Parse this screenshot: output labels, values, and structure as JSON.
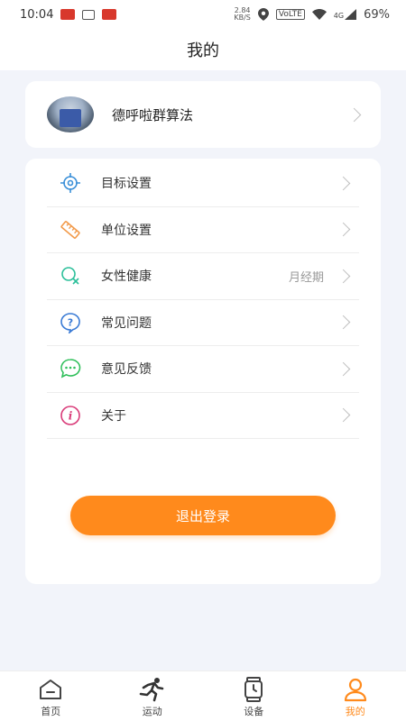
{
  "status_bar": {
    "time": "10:04",
    "speed_value": "2.84",
    "speed_unit": "KB/S",
    "volte": "VoLTE",
    "network": "4G",
    "battery": "69%"
  },
  "header": {
    "title": "我的"
  },
  "profile": {
    "name": "德呼啦群算法"
  },
  "menu": {
    "items": [
      {
        "label": "目标设置",
        "value": ""
      },
      {
        "label": "单位设置",
        "value": ""
      },
      {
        "label": "女性健康",
        "value": "月经期"
      },
      {
        "label": "常见问题",
        "value": ""
      },
      {
        "label": "意见反馈",
        "value": ""
      },
      {
        "label": "关于",
        "value": ""
      }
    ]
  },
  "logout_label": "退出登录",
  "tabs": [
    {
      "label": "首页",
      "active": false
    },
    {
      "label": "运动",
      "active": false
    },
    {
      "label": "设备",
      "active": false
    },
    {
      "label": "我的",
      "active": true
    }
  ],
  "colors": {
    "accent": "#ff8a1c",
    "background": "#f2f4fa"
  }
}
